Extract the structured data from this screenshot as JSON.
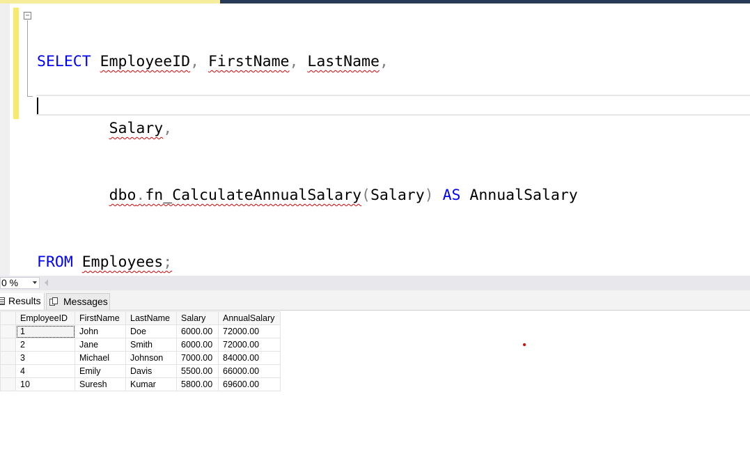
{
  "editor": {
    "lines": [
      [
        "SELECT",
        "EmployeeID",
        ",",
        "FirstName",
        ",",
        "LastName",
        ","
      ],
      [
        "Salary",
        ","
      ],
      [
        "dbo",
        ".",
        "fn_CalculateAnnualSalary",
        "(",
        "Salary",
        ")",
        "AS",
        "AnnualSalary"
      ],
      [
        "FROM",
        "Employees",
        ";"
      ]
    ]
  },
  "zoom": {
    "value": "0 %"
  },
  "result_tabs": {
    "results": "Results",
    "messages": "Messages"
  },
  "grid": {
    "headers": [
      "EmployeeID",
      "FirstName",
      "LastName",
      "Salary",
      "AnnualSalary"
    ],
    "rows": [
      [
        "1",
        "John",
        "Doe",
        "6000.00",
        "72000.00"
      ],
      [
        "2",
        "Jane",
        "Smith",
        "6000.00",
        "72000.00"
      ],
      [
        "3",
        "Michael",
        "Johnson",
        "7000.00",
        "84000.00"
      ],
      [
        "4",
        "Emily",
        "Davis",
        "5500.00",
        "66000.00"
      ],
      [
        "10",
        "Suresh",
        "Kumar",
        "5800.00",
        "69600.00"
      ]
    ]
  },
  "colors": {
    "keyword": "#0000ff",
    "operator": "#808080",
    "squiggle": "#e00000",
    "change_bar": "#f7e96b"
  },
  "icons": [
    "collapse-box-icon",
    "results-grid-icon",
    "messages-icon",
    "dropdown-arrow-icon",
    "scroll-left-icon"
  ]
}
